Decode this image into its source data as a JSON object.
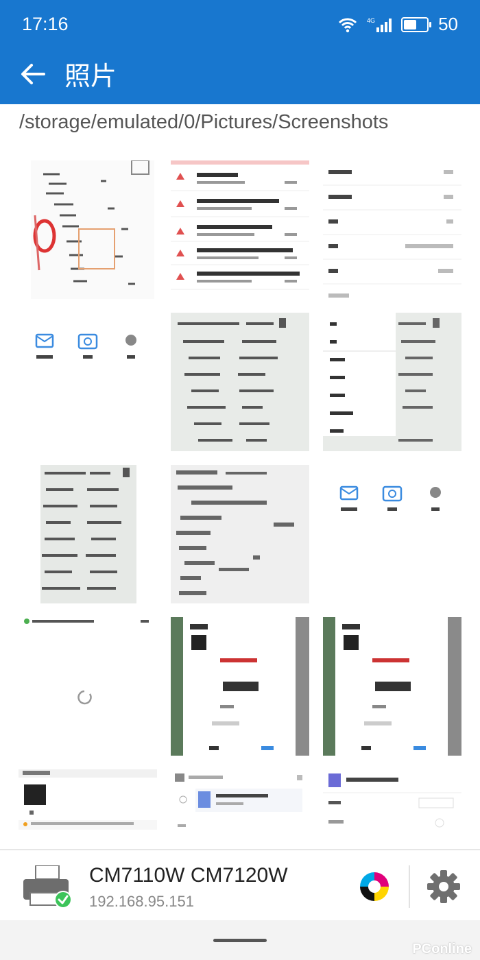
{
  "status_bar": {
    "time": "17:16",
    "battery": "50",
    "network": "4G"
  },
  "header": {
    "title": "照片"
  },
  "path": "/storage/emulated/0/Pictures/Screenshots",
  "thumbnails": [
    {
      "name": "screenshot-1"
    },
    {
      "name": "screenshot-2"
    },
    {
      "name": "screenshot-3"
    },
    {
      "name": "screenshot-4"
    },
    {
      "name": "screenshot-5"
    },
    {
      "name": "screenshot-6"
    },
    {
      "name": "screenshot-7"
    },
    {
      "name": "screenshot-8"
    },
    {
      "name": "screenshot-9"
    },
    {
      "name": "screenshot-10"
    },
    {
      "name": "screenshot-11"
    },
    {
      "name": "screenshot-12"
    },
    {
      "name": "screenshot-13"
    },
    {
      "name": "screenshot-14"
    },
    {
      "name": "screenshot-15"
    }
  ],
  "printer": {
    "name": "CM7110W CM7120W",
    "ip": "192.168.95.151"
  },
  "watermark": "PConline",
  "colors": {
    "accent": "#1877cf",
    "success": "#3cc45a"
  }
}
